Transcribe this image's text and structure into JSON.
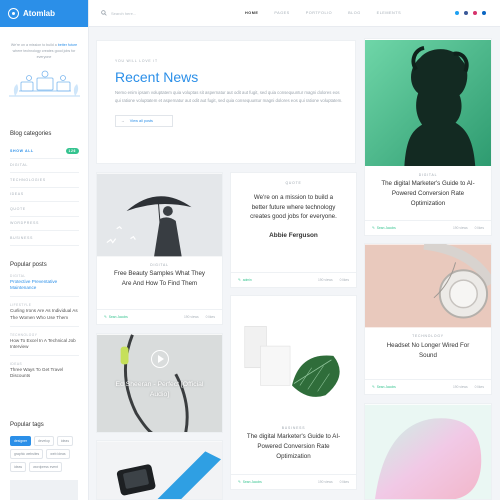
{
  "app": {
    "name": "Atomlab"
  },
  "sidebar": {
    "tagline_prefix": "We're on a mission to build a",
    "tagline_highlight1": "better",
    "tagline_highlight2": "future",
    "tagline_mid": "where technology creates good jobs for everyone",
    "categories_title": "Blog categories",
    "categories": [
      {
        "label": "SHOW ALL",
        "count": "126",
        "active": true
      },
      {
        "label": "DIGITAL"
      },
      {
        "label": "TECHNOLOGIES"
      },
      {
        "label": "IDEAS"
      },
      {
        "label": "QUOTE"
      },
      {
        "label": "WORDPRESS"
      },
      {
        "label": "BUSINESS"
      }
    ],
    "popular_title": "Popular posts",
    "posts": [
      {
        "cat": "DIGITAL",
        "title": "Protective Preventative Maintenance"
      },
      {
        "cat": "LIFESTYLE",
        "title": "Curling Irons Are As Individual As The Women Who Use Them"
      },
      {
        "cat": "TECHNOLOGY",
        "title": "How To Excel In A Technical Job Interview"
      },
      {
        "cat": "IDEAS",
        "title": "Three Ways To Get Travel Discounts"
      }
    ],
    "tags_title": "Popular tags",
    "tags": [
      "designer",
      "develop",
      "ideas",
      "graphic websites",
      "web ideas",
      "ideas",
      "wordpress event"
    ]
  },
  "header": {
    "search_placeholder": "Search here...",
    "nav": [
      "HOME",
      "PAGES",
      "PORTFOLIO",
      "BLOG",
      "ELEMENTS"
    ],
    "colors": {
      "twitter": "#1da1f2",
      "facebook": "#3b5998",
      "instagram": "#d6336c",
      "linkedin": "#0a66c2"
    }
  },
  "recent": {
    "kicker": "YOU WILL LOVE IT",
    "title": "Recent News",
    "body": "Nemo enim ipsam voluptatem quia voluptas sit aspernatur aut odit aut fugit, sed quia consequuntur magni dolores eos qui ratione voluptatem et aspernatur aut odit aut fugit, sed quia consequuntur magni dolores eos qui ratione voluptatem.",
    "button": "View all posts"
  },
  "cards": {
    "umbrella": {
      "kicker": "DIGITAL",
      "title": "Free Beauty Samples What They Are And How To Find Them",
      "author": "Sean Jacobs",
      "views": "190 views",
      "likes": "0 likes"
    },
    "quote": {
      "kicker": "QUOTE",
      "text": "We're on a mission to build a better future where technology creates good jobs for everyone.",
      "name": "Abbie Ferguson",
      "author": "admin",
      "views": "190 views",
      "likes": "0 likes"
    },
    "woman": {
      "kicker": "DIGITAL",
      "title": "The digital Marketer's Guide to AI-Powered Conversion Rate Optimization",
      "author": "Sean Jacobs",
      "views": "190 views",
      "likes": "0 likes"
    },
    "headset": {
      "kicker": "TECHNOLOGY",
      "title": "Headset No Longer Wired For Sound",
      "author": "Sean Jacobs",
      "views": "190 views",
      "likes": "0 likes"
    },
    "video": {
      "title": "Ed Sheeran - Perfect [Official Audio]"
    },
    "business": {
      "kicker": "BUSINESS",
      "title": "The digital Marketer's Guide to AI-Powered Conversion Rate Optimization",
      "author": "Sean Jacobs",
      "views": "190 views",
      "likes": "0 likes"
    }
  }
}
